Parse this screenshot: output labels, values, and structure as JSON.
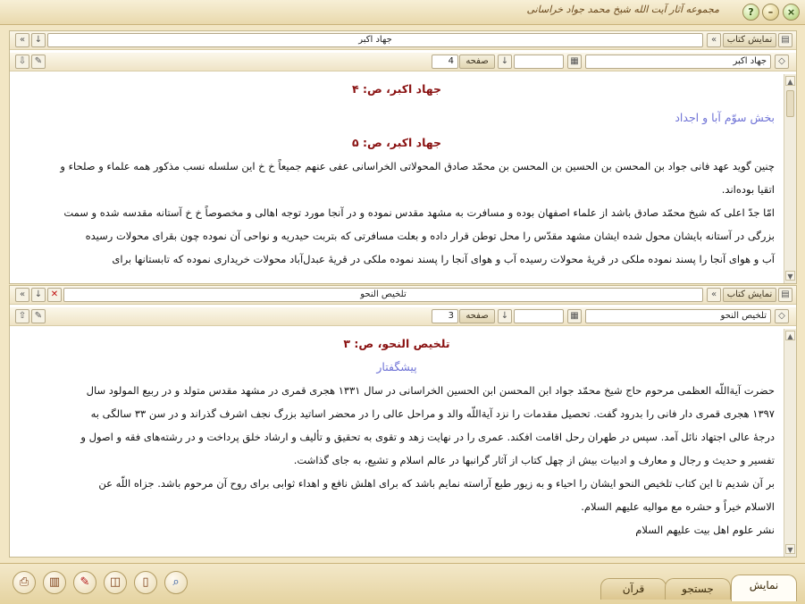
{
  "app": {
    "title": "مجموعه آثار آیت الله شیخ محمد جواد خراسانی"
  },
  "panel1": {
    "show_book_label": "نمایش کتاب",
    "book_title": "جهاد اکبر",
    "page_label": "صفحه",
    "page_value": "4",
    "book_select": "جهاد اکبر",
    "header1": "جهاد اکبر، ص: ۴",
    "section": "بخش سوّم آبا و اجداد",
    "header2": "جهاد اکبر، ص: ۵",
    "lines": [
      "چنین گوید عهد فانی جواد بن المحسن بن الحسین بن المحسن بن محمّد صادق المحولاتی الخراسانی عفی عنهم جمیعاً خ خ این سلسله نسب مذکور همه علماء و صلحاء و",
      "اتقیا بوده‌اند.",
      "امّا جدّ اعلی که شیخ محمّد صادق باشد از علماء اصفهان بوده و مسافرت به مشهد مقدس نموده و در آنجا مورد توجه اهالی و مخصوصاً خ خ آستانه مقدسه شده و سمت",
      "بزرگی در آستانه بایشان محول شده ایشان مشهد مقدّس را محل توطن قرار داده و بعلت مسافرتی که بتربت حیدریه و نواحی آن نموده چون بقرای محولات رسیده",
      "آب و هوای آنجا را پسند نموده ملکی در قریهٔ محولات رسیده آب و هوای آنجا را پسند نموده ملکی در قریهٔ عبدل‌آباد محولات خریداری نموده که تابستانها برای"
    ]
  },
  "panel2": {
    "show_book_label": "نمایش کتاب",
    "book_title": "تلخیص النحو",
    "page_label": "صفحه",
    "page_value": "3",
    "book_select": "تلخیص النحو",
    "header1": "تلخیص النحو، ص: ۳",
    "section": "پیشگفتار",
    "lines": [
      "حضرت آیة‌اللّه العظمی مرحوم حاج شیخ محمّد جواد ابن المحسن ابن الحسین الخراسانی در سال ۱۳۳۱ هجری قمری در مشهد مقدس متولد و در ربیع المولود سال",
      "۱۳۹۷ هجری قمری دار فانی را بدرود گفت. تحصیل مقدمات را نزد آیة‌اللّه والد و مراحل عالی را در محضر اساتید بزرگ نجف اشرف گذراند و در سن ۳۳ سالگی به",
      "درجهٔ عالی اجتهاد نائل آمد. سپس در طهران رحل اقامت افکند. عمری را در نهایت زهد و تقوی به تحقیق و تألیف و ارشاد خلق پرداخت و در رشته‌های فقه و اصول و",
      "تفسیر و حدیث و رجال و معارف و ادبیات بیش از چهل کتاب از آثار گرانبها در عالم اسلام و تشیع، به جای گذاشت.",
      "بر آن شدیم تا این کتاب تلخیص النحو ایشان را احیاء و به زیور طبع آراسته نمایم باشد که برای اهلش نافع و اهداء ثوابی برای روح آن مرحوم باشد. جزاه اللّه عن",
      "الاسلام خیراً و حشره مع موالیه علیهم السلام.",
      "نشر علوم اهل بیت علیهم السلام"
    ]
  },
  "tabs": [
    "نمایش",
    "جستجو",
    "قرآن"
  ],
  "icons": {
    "close": "close-icon",
    "minimize": "minimize-icon",
    "help": "help-icon"
  }
}
